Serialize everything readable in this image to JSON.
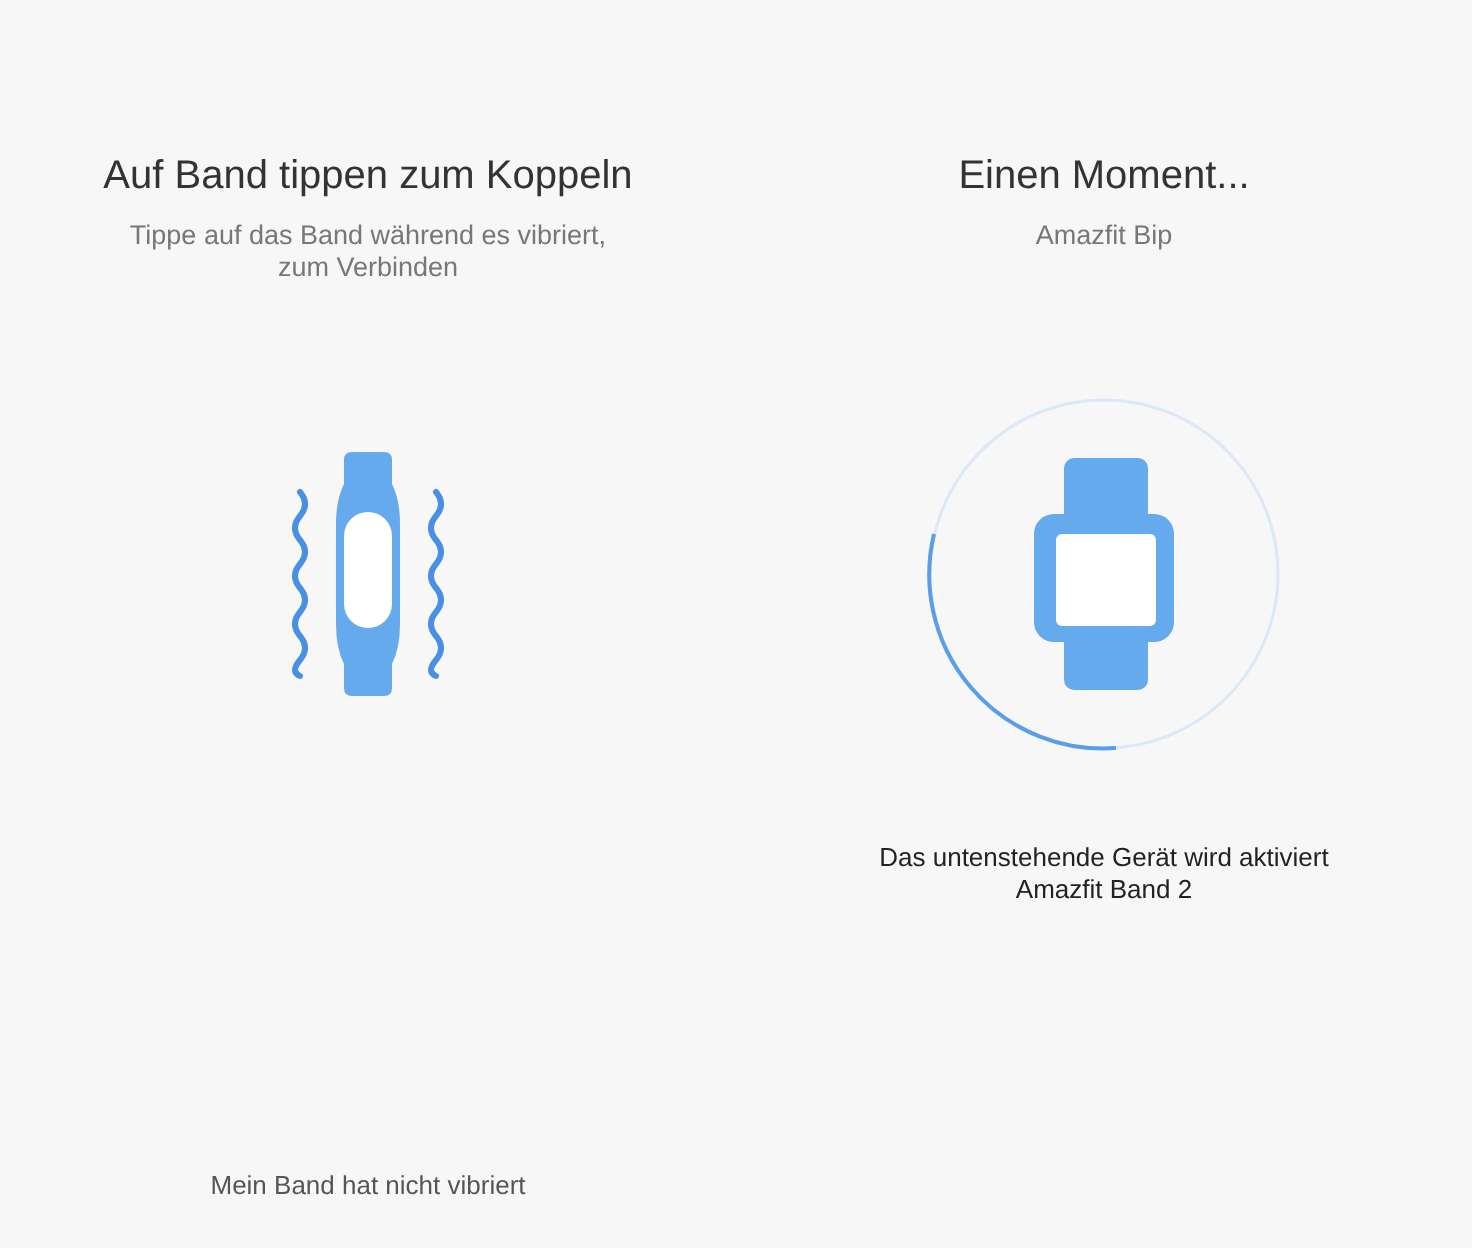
{
  "left": {
    "title": "Auf Band tippen zum Koppeln",
    "subtitle": "Tippe auf das Band während es vibriert, zum Verbinden",
    "link": "Mein Band hat nicht vibriert"
  },
  "right": {
    "title": "Einen Moment...",
    "subtitle": "Amazfit Bip",
    "status": "Das untenstehende Gerät wird aktiviert",
    "device": "Amazfit Band 2"
  }
}
